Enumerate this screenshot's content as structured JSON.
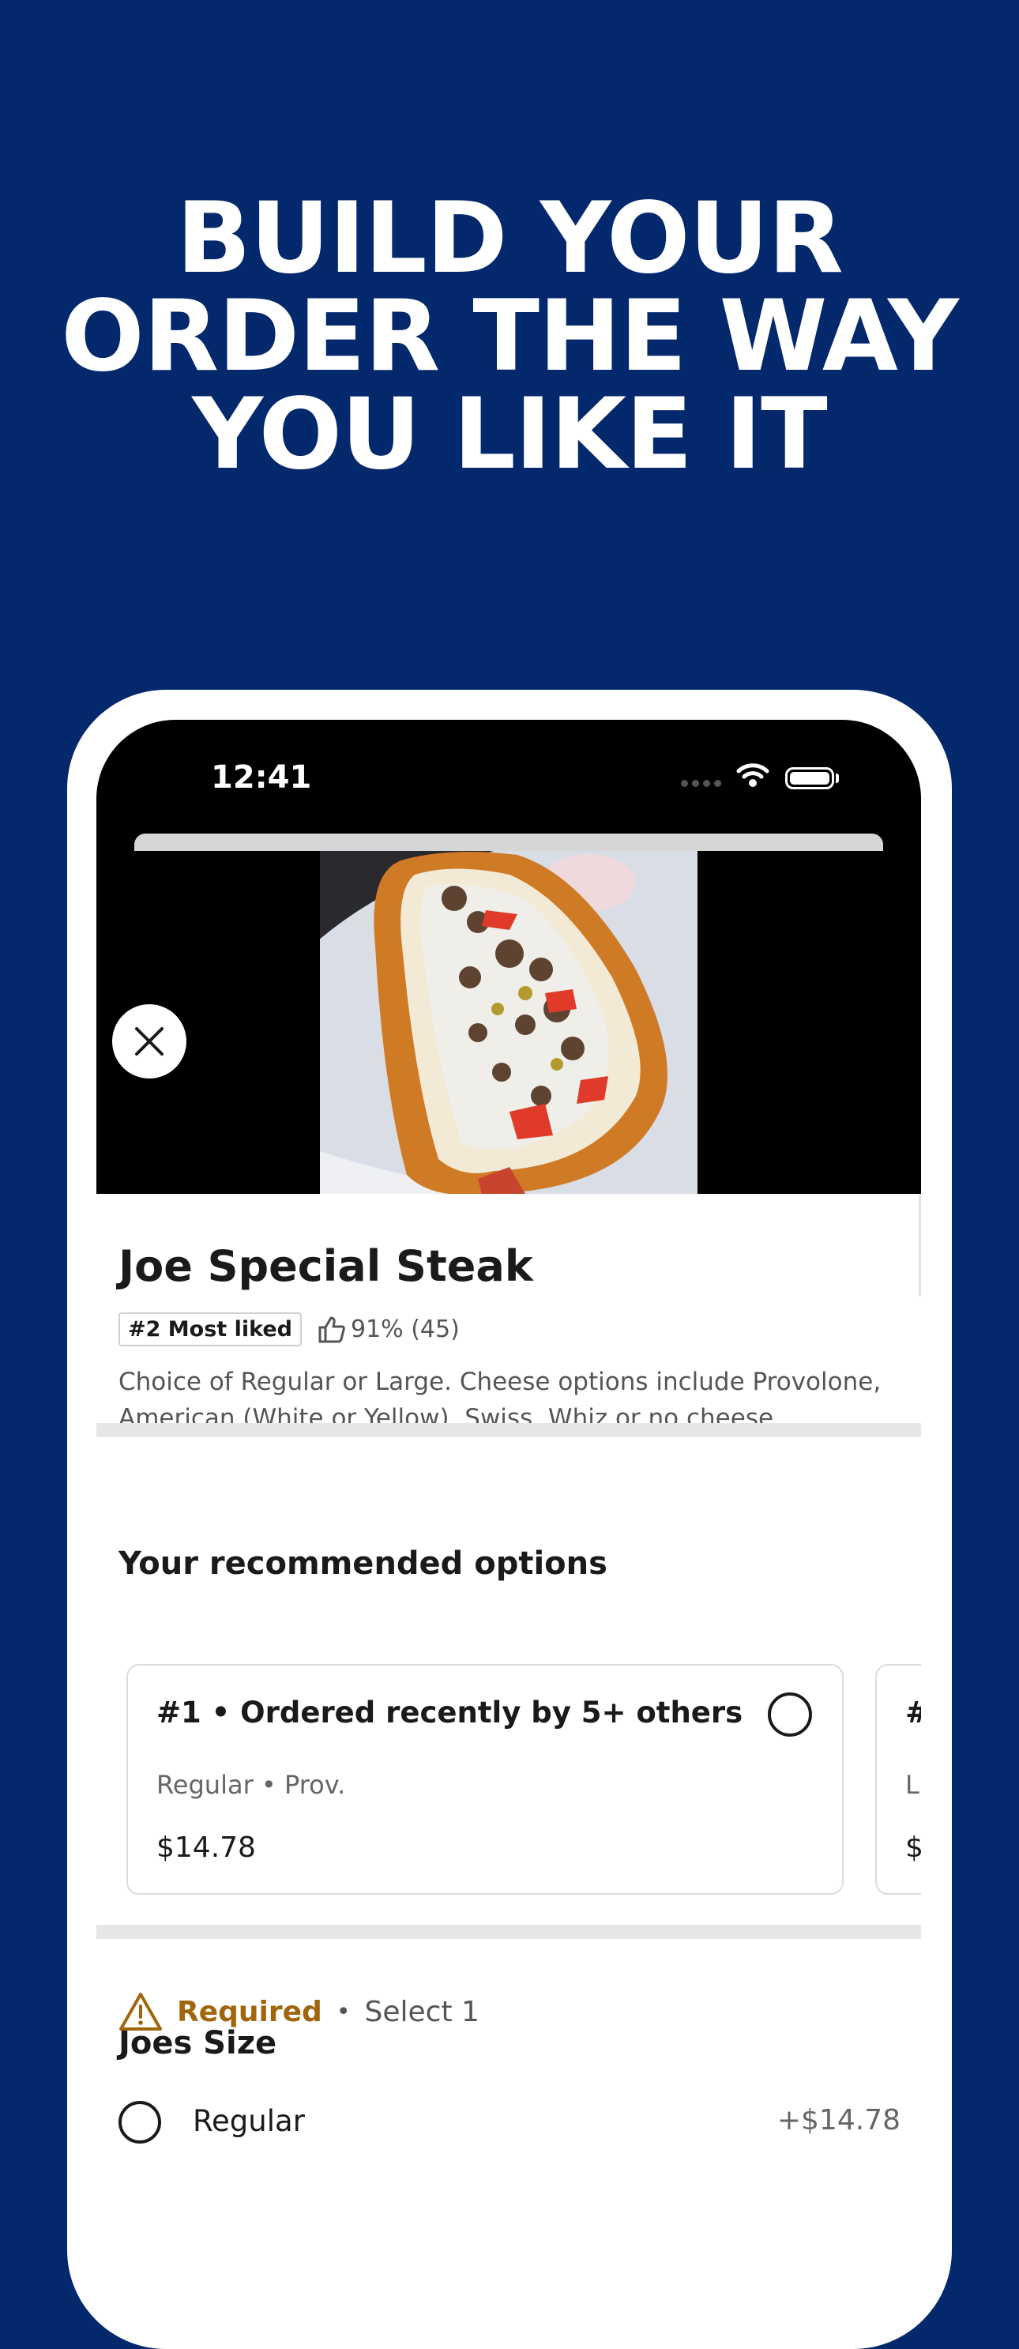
{
  "headline": {
    "line1": "BUILD YOUR",
    "line2": "ORDER THE WAY",
    "line3": "YOU LIKE IT"
  },
  "status_bar": {
    "time": "12:41"
  },
  "item": {
    "title": "Joe Special Steak",
    "badge": "#2 Most liked",
    "rating": "91% (45)",
    "description": "Choice of Regular or Large. Cheese options include Provolone, American (White or Yellow), Swiss, Whiz or no cheese."
  },
  "recommended": {
    "heading": "Your recommended options",
    "cards": [
      {
        "title": "#1 • Ordered recently by 5+ others",
        "sub": "Regular • Prov.",
        "price": "$14.78"
      },
      {
        "title": "#",
        "sub": "L",
        "price": "$"
      }
    ]
  },
  "size_section": {
    "heading": "Joes Size",
    "required_label": "Required",
    "separator": "•",
    "select_label": "Select 1",
    "options": [
      {
        "label": "Regular",
        "price": "+$14.78"
      }
    ]
  },
  "colors": {
    "background": "#03286c",
    "required": "#a1660d"
  }
}
